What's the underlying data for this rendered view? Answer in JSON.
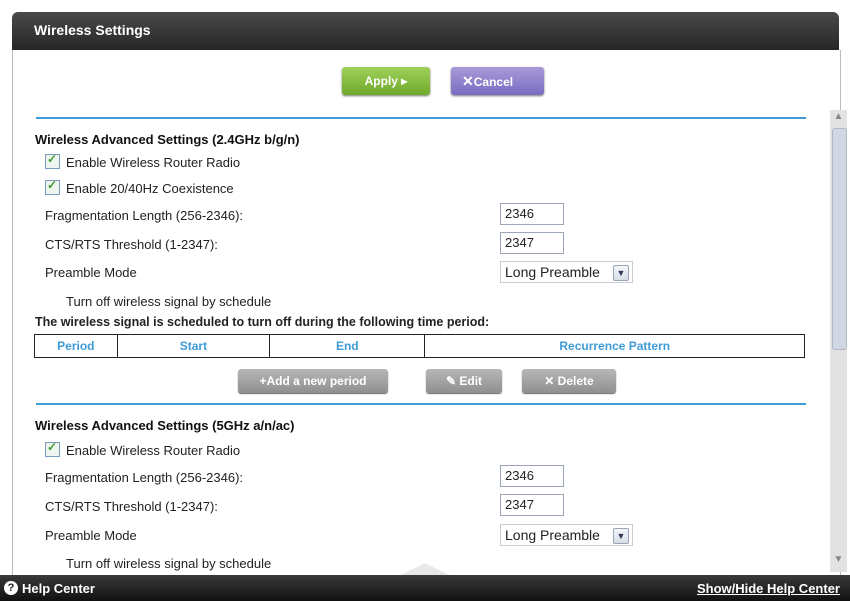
{
  "header": {
    "title": "Wireless Settings"
  },
  "toolbar": {
    "apply_label": "Apply ▸",
    "cancel_label": "Cancel"
  },
  "section24": {
    "title": "Wireless Advanced Settings (2.4GHz b/g/n)",
    "enable_radio_label": "Enable Wireless Router Radio",
    "enable_radio_checked": true,
    "coexistence_label": "Enable 20/40Hz Coexistence",
    "coexistence_checked": true,
    "frag_label": "Fragmentation Length (256-2346):",
    "frag_value": "2346",
    "cts_label": "CTS/RTS Threshold (1-2347):",
    "cts_value": "2347",
    "preamble_label": "Preamble Mode",
    "preamble_value": "Long Preamble",
    "schedule_off_label": "Turn off wireless signal by schedule",
    "schedule_note": "The wireless signal is scheduled to turn off during the following time period:",
    "table_headers": [
      "Period",
      "Start",
      "End",
      "Recurrence Pattern"
    ],
    "add_period_label": "+Add a new period",
    "edit_label": "Edit",
    "delete_label": "Delete"
  },
  "section5": {
    "title": "Wireless Advanced Settings (5GHz a/n/ac)",
    "enable_radio_label": "Enable Wireless Router Radio",
    "enable_radio_checked": true,
    "frag_label": "Fragmentation Length (256-2346):",
    "frag_value": "2346",
    "cts_label": "CTS/RTS Threshold (1-2347):",
    "cts_value": "2347",
    "preamble_label": "Preamble Mode",
    "preamble_value": "Long Preamble",
    "schedule_off_label": "Turn off wireless signal by schedule"
  },
  "footer": {
    "help_center": "Help Center",
    "show_hide": "Show/Hide Help Center"
  }
}
